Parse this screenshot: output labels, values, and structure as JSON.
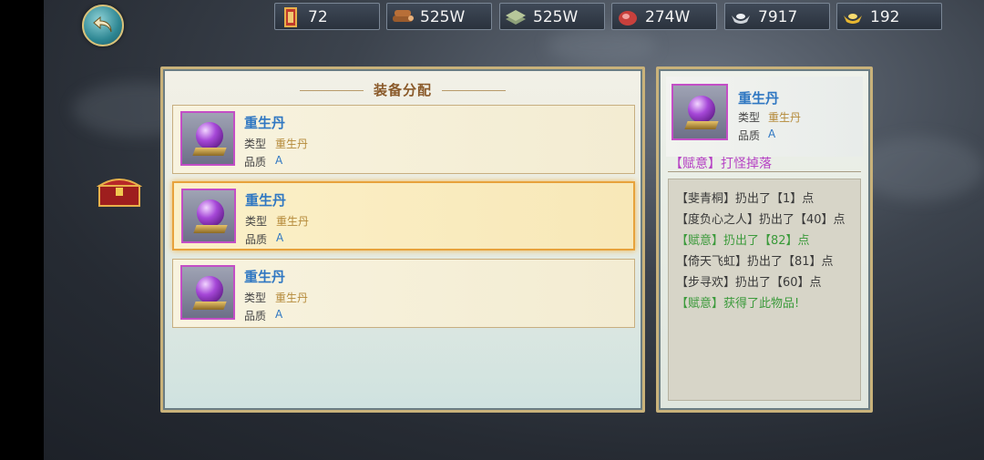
{
  "resources": [
    {
      "icon": "scroll-icon",
      "value": "72"
    },
    {
      "icon": "wood-icon",
      "value": "525W"
    },
    {
      "icon": "stone-icon",
      "value": "525W"
    },
    {
      "icon": "meat-icon",
      "value": "274W"
    },
    {
      "icon": "silver-ingot-icon",
      "value": "7917"
    },
    {
      "icon": "gold-ingot-icon",
      "value": "192"
    }
  ],
  "panel": {
    "title": "装备分配"
  },
  "items": [
    {
      "name": "重生丹",
      "type_label": "类型",
      "type_value": "重生丹",
      "quality_label": "品质",
      "quality_value": "A"
    },
    {
      "name": "重生丹",
      "type_label": "类型",
      "type_value": "重生丹",
      "quality_label": "品质",
      "quality_value": "A"
    },
    {
      "name": "重生丹",
      "type_label": "类型",
      "type_value": "重生丹",
      "quality_label": "品质",
      "quality_value": "A"
    }
  ],
  "detail": {
    "name": "重生丹",
    "type_label": "类型",
    "type_value": "重生丹",
    "quality_label": "品质",
    "quality_value": "A",
    "source": "【赋意】打怪掉落"
  },
  "roll_log": [
    {
      "text": "【斐青桐】扔出了【1】点",
      "style": "normal"
    },
    {
      "text": "【度负心之人】扔出了【40】点",
      "style": "normal"
    },
    {
      "text": "【赋意】扔出了【82】点",
      "style": "mine"
    },
    {
      "text": "【倚天飞虹】扔出了【81】点",
      "style": "normal"
    },
    {
      "text": "【步寻欢】扔出了【60】点",
      "style": "normal"
    },
    {
      "text": "【赋意】获得了此物品!",
      "style": "mine"
    }
  ],
  "colors": {
    "item_name": "#2f77c2",
    "type_value": "#b58a3a",
    "source": "#b642c4",
    "winner": "#3b9a3b"
  }
}
